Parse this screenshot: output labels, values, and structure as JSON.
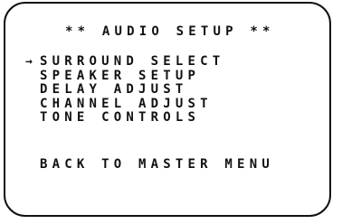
{
  "osd": {
    "title": "** AUDIO SETUP **",
    "cursor": "→",
    "menu_items": [
      {
        "label": "SURROUND SELECT",
        "selected": true
      },
      {
        "label": "SPEAKER SETUP",
        "selected": false
      },
      {
        "label": "DELAY ADJUST",
        "selected": false
      },
      {
        "label": "CHANNEL ADJUST",
        "selected": false
      },
      {
        "label": "TONE CONTROLS",
        "selected": false
      }
    ],
    "back_label": "BACK TO MASTER MENU"
  }
}
